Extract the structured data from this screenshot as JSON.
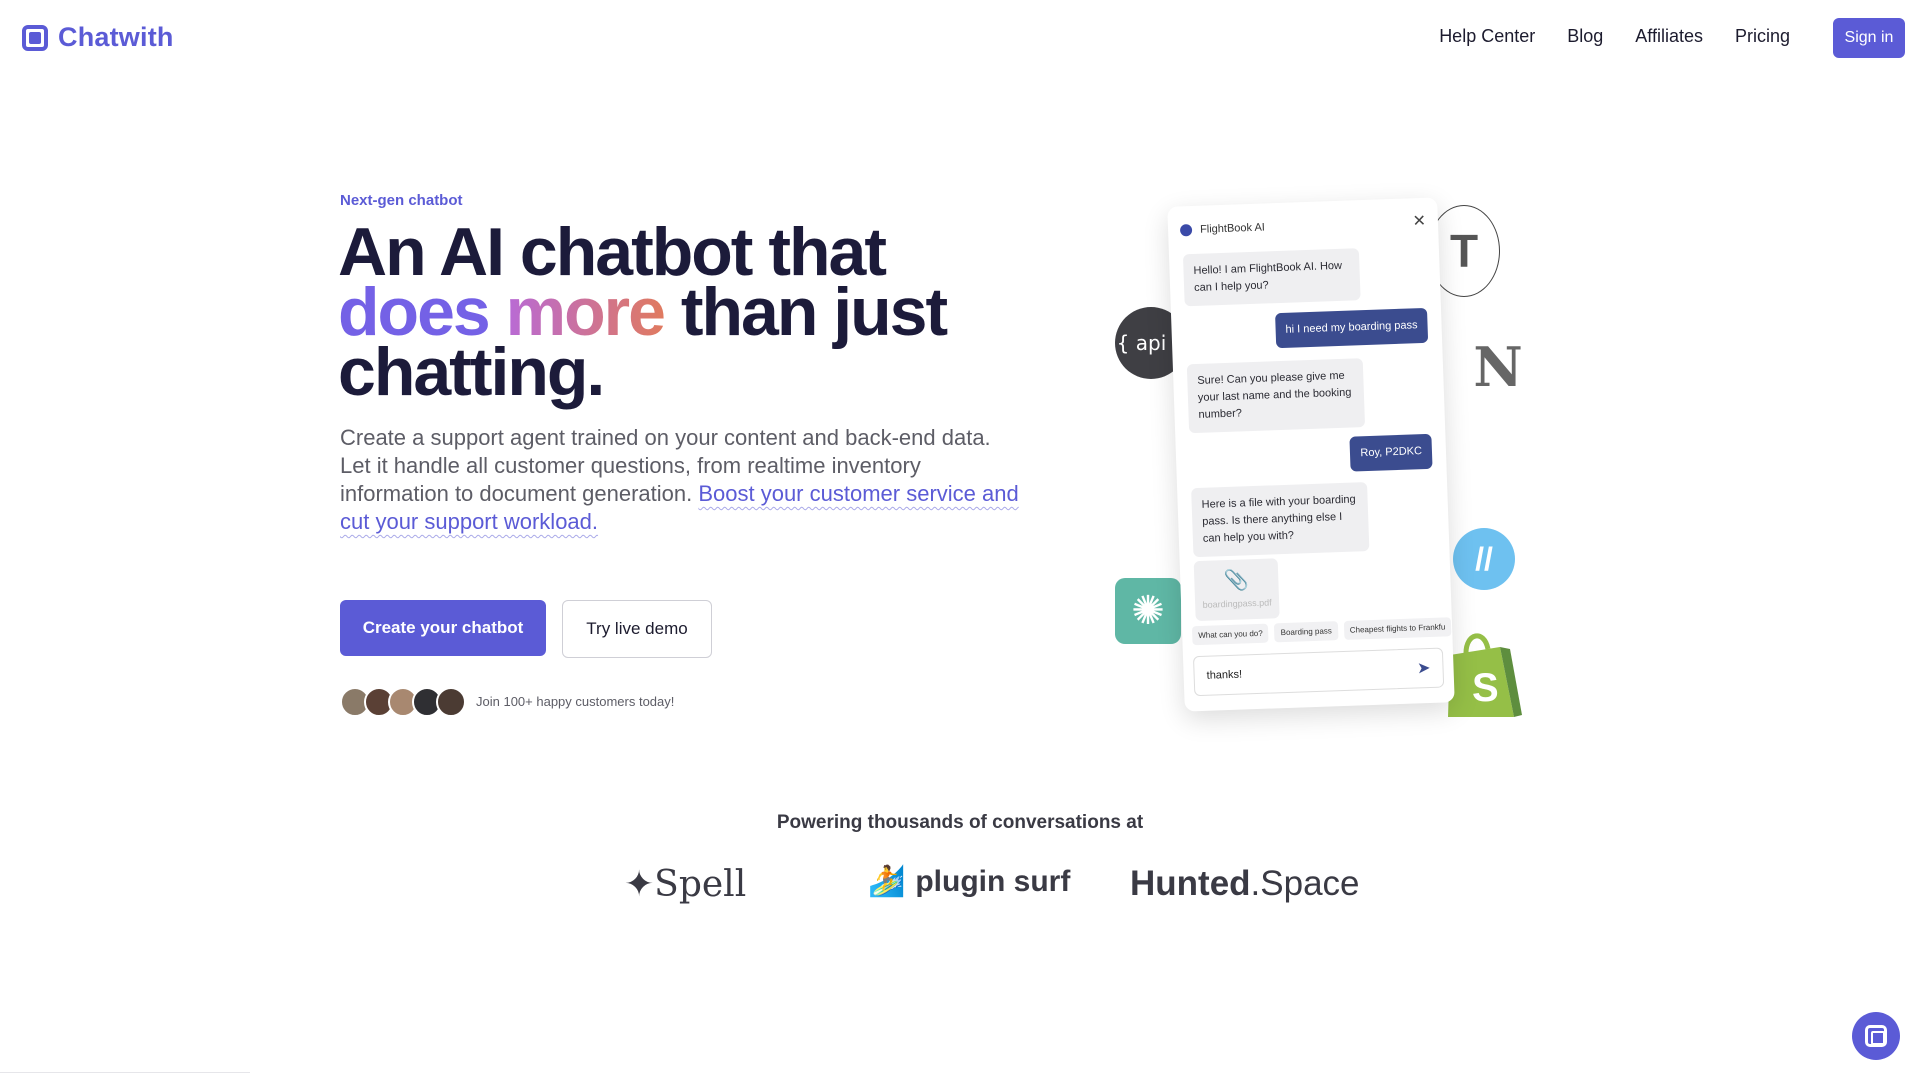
{
  "brand": {
    "name": "Chatwith"
  },
  "nav": {
    "links": [
      "Help Center",
      "Blog",
      "Affiliates",
      "Pricing"
    ],
    "signin": "Sign in"
  },
  "hero": {
    "eyebrow": "Next-gen chatbot",
    "headline_line1": "An AI chatbot that",
    "headline_word_does": "does",
    "headline_word_more": "more",
    "headline_line2_rest": "than just",
    "headline_line3": "chatting.",
    "lead": "Create a support agent trained on your content and back-end data. Let it handle all customer questions, from realtime inventory information to document generation.",
    "lead_highlight": "Boost your customer service and cut your support workload.",
    "cta_primary": "Create your chatbot",
    "cta_secondary": "Try live demo",
    "social_proof": "Join 100+ happy customers today!"
  },
  "demo": {
    "api_label": "{ api }",
    "typeform_letter": "T",
    "notion_letter": "N",
    "bot_name": "FlightBook AI",
    "messages": [
      {
        "from": "bot",
        "text": "Hello! I am FlightBook AI. How can I help you?"
      },
      {
        "from": "user",
        "text": "hi I need my boarding pass"
      },
      {
        "from": "bot",
        "text": "Sure! Can you please give me your last name and the booking number?"
      },
      {
        "from": "user",
        "text": "Roy, P2DKC"
      },
      {
        "from": "bot",
        "text": "Here is a file with your boarding pass. Is there anything else I can help you with?"
      }
    ],
    "attachment": "boardingpass.pdf",
    "suggestions": [
      "What can you do?",
      "Boarding pass",
      "Cheapest flights to Frankfu"
    ],
    "input_value": "thanks!"
  },
  "logos": {
    "title": "Powering thousands of conversations at",
    "spell": "Spell",
    "plugin": "plugin surf",
    "hunted_bold": "Hunted",
    "hunted_rest": ".Space"
  },
  "colors": {
    "accent": "#5b5bd6",
    "dark": "#1c1b3a",
    "user_bubble": "#3b4c8f"
  }
}
